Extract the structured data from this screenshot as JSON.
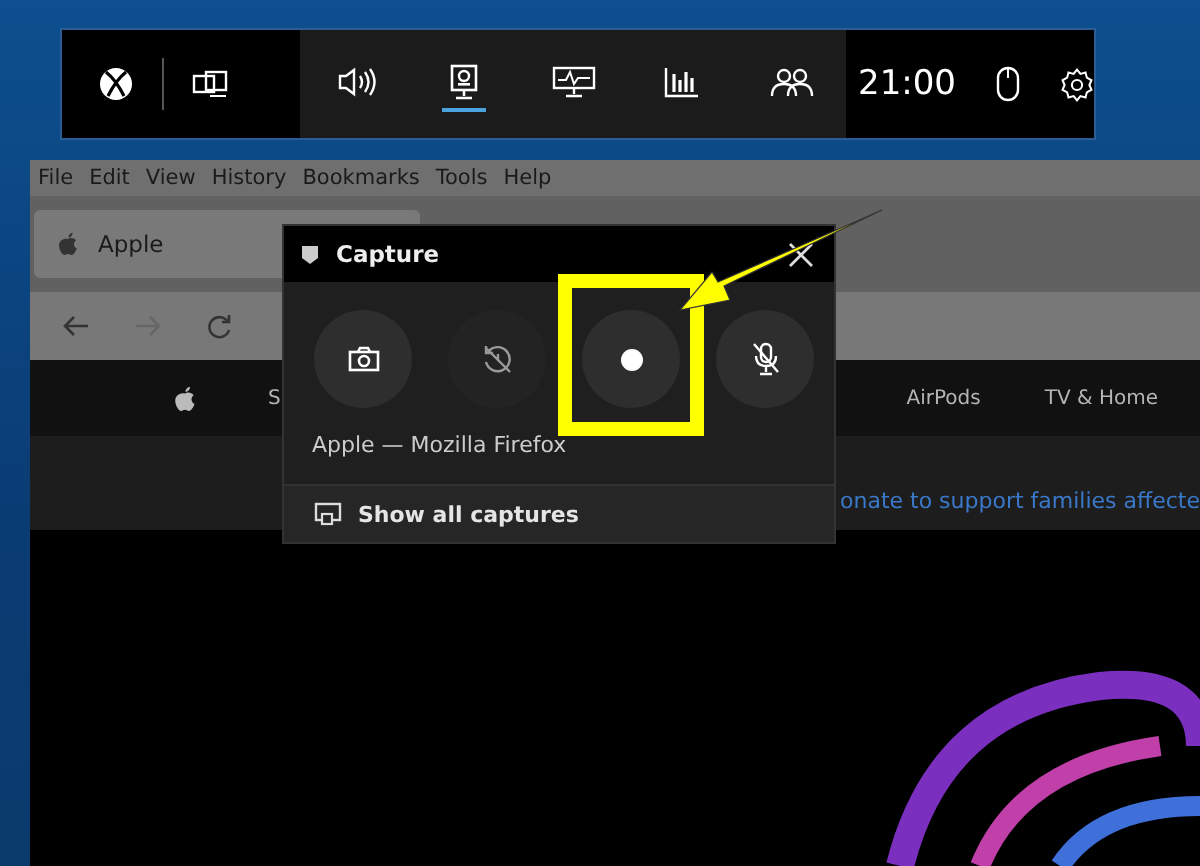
{
  "game_bar": {
    "widgets": [
      {
        "kind": "audio",
        "selected": false
      },
      {
        "kind": "capture",
        "selected": true
      },
      {
        "kind": "performance",
        "selected": false
      },
      {
        "kind": "resources",
        "selected": false
      },
      {
        "kind": "social",
        "selected": false
      }
    ],
    "time": "21:00"
  },
  "browser": {
    "menu": [
      "File",
      "Edit",
      "View",
      "History",
      "Bookmarks",
      "Tools",
      "Help"
    ],
    "tab": {
      "title": "Apple"
    },
    "site_nav": [
      "S",
      "AirPods",
      "TV & Home"
    ],
    "banner": "onate to support families affecte"
  },
  "capture": {
    "title": "Capture",
    "buttons": [
      {
        "kind": "screenshot",
        "disabled": false
      },
      {
        "kind": "record-last",
        "disabled": true
      },
      {
        "kind": "record",
        "disabled": false
      },
      {
        "kind": "mic",
        "disabled": false
      }
    ],
    "target": "Apple — Mozilla Firefox",
    "show_all": "Show all captures"
  }
}
